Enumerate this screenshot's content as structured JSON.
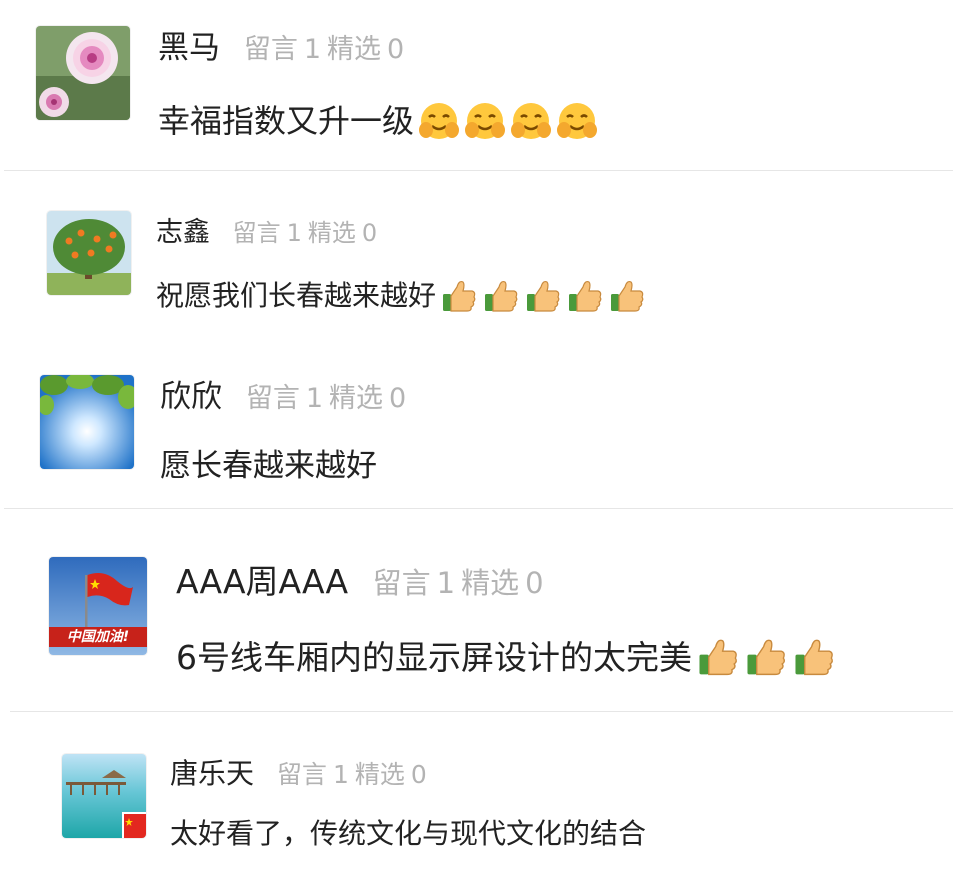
{
  "comments": [
    {
      "user": "黑马",
      "stats": {
        "reply_label": "留言",
        "reply_count": "1",
        "featured_label": "精选",
        "featured_count": "0"
      },
      "content": "幸福指数又升一级",
      "emoji": "grinning-hands-emoji",
      "emoji_count": 4,
      "avatar": "pink-flower-avatar"
    },
    {
      "user": "志鑫",
      "stats": {
        "reply_label": "留言",
        "reply_count": "1",
        "featured_label": "精选",
        "featured_count": "0"
      },
      "content": "祝愿我们长春越来越好",
      "emoji": "thumbs-up-emoji",
      "emoji_count": 5,
      "avatar": "orange-tree-avatar"
    },
    {
      "user": "欣欣",
      "stats": {
        "reply_label": "留言",
        "reply_count": "1",
        "featured_label": "精选",
        "featured_count": "0"
      },
      "content": "愿长春越来越好",
      "emoji": "",
      "emoji_count": 0,
      "avatar": "sun-leaves-avatar"
    },
    {
      "user": "AAA周AAA",
      "stats": {
        "reply_label": "留言",
        "reply_count": "1",
        "featured_label": "精选",
        "featured_count": "0"
      },
      "content": "6号线车厢内的显示屏设计的太完美",
      "emoji": "thumbs-up-emoji",
      "emoji_count": 3,
      "avatar": "china-flag-avatar",
      "avatar_text": "中国加油!"
    },
    {
      "user": "唐乐天",
      "stats": {
        "reply_label": "留言",
        "reply_count": "1",
        "featured_label": "精选",
        "featured_count": "0"
      },
      "content": "太好看了，传统文化与现代文化的结合",
      "emoji": "",
      "emoji_count": 0,
      "avatar": "sea-pier-avatar"
    }
  ],
  "colors": {
    "name": "#222222",
    "stats": "#b3b3b3",
    "divider": "#e6e6e6"
  }
}
